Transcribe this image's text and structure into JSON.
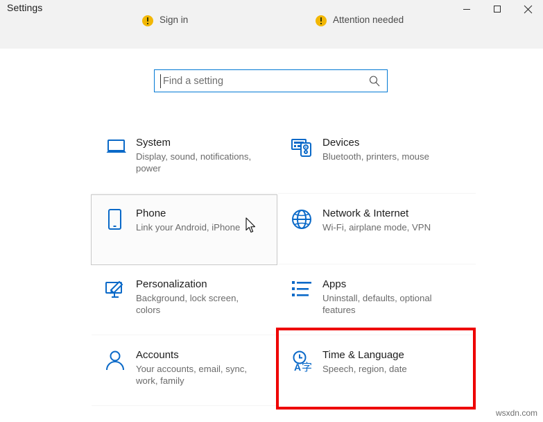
{
  "window": {
    "title": "Settings",
    "controls": [
      {
        "name": "minimize",
        "glyph": "minimize-icon"
      },
      {
        "name": "maximize",
        "glyph": "maximize-icon"
      },
      {
        "name": "close",
        "glyph": "close-icon"
      }
    ]
  },
  "cut_off_row": [
    {
      "icon": "warning-badge-icon",
      "label": "Sign in"
    },
    {
      "icon": "warning-badge-icon",
      "label": "Attention needed"
    }
  ],
  "search": {
    "placeholder": "Find a setting",
    "value": "",
    "icon": "search-icon"
  },
  "tiles": [
    {
      "icon": "laptop-icon",
      "title": "System",
      "subtitle": "Display, sound, notifications, power",
      "state": "normal"
    },
    {
      "icon": "keyboard-device-icon",
      "title": "Devices",
      "subtitle": "Bluetooth, printers, mouse",
      "state": "normal"
    },
    {
      "icon": "phone-icon",
      "title": "Phone",
      "subtitle": "Link your Android, iPhone",
      "state": "hovered"
    },
    {
      "icon": "globe-icon",
      "title": "Network & Internet",
      "subtitle": "Wi-Fi, airplane mode, VPN",
      "state": "normal"
    },
    {
      "icon": "monitor-brush-icon",
      "title": "Personalization",
      "subtitle": "Background, lock screen, colors",
      "state": "normal"
    },
    {
      "icon": "app-list-icon",
      "title": "Apps",
      "subtitle": "Uninstall, defaults, optional features",
      "state": "normal"
    },
    {
      "icon": "person-icon",
      "title": "Accounts",
      "subtitle": "Your accounts, email, sync, work, family",
      "state": "normal"
    },
    {
      "icon": "clock-language-icon",
      "title": "Time & Language",
      "subtitle": "Speech, region, date",
      "state": "highlighted"
    }
  ],
  "annotation": {
    "type": "red-rectangle",
    "color": "#ee0000",
    "targets": "Time & Language"
  },
  "watermark": "wsxdn.com",
  "colors": {
    "accent": "#0078d4",
    "icon_blue": "#0a69c8",
    "titlebar_bg": "#f2f2f2",
    "page_bg": "#ffffff",
    "warning_yellow": "#f2b705",
    "annotation_red": "#ee0000"
  }
}
